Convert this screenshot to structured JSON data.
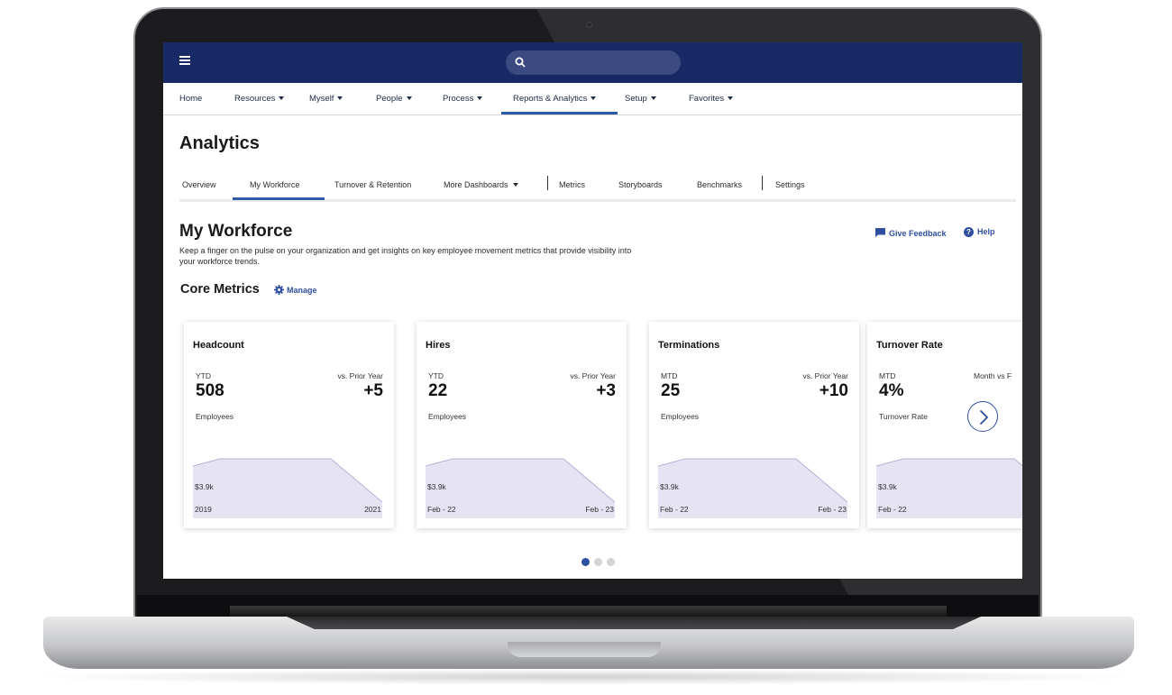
{
  "topbar": {
    "menu_icon": "hamburger-menu-icon",
    "search_icon": "search-icon",
    "colors": {
      "bar": "#172a66",
      "search": "#3b4a80"
    }
  },
  "main_nav": {
    "items": [
      {
        "label": "Home",
        "has_caret": false
      },
      {
        "label": "Resources",
        "has_caret": true
      },
      {
        "label": "Myself",
        "has_caret": true
      },
      {
        "label": "People",
        "has_caret": true
      },
      {
        "label": "Process",
        "has_caret": true
      },
      {
        "label": "Reports & Analytics",
        "has_caret": true,
        "active": true
      },
      {
        "label": "Setup",
        "has_caret": true
      },
      {
        "label": "Favorites",
        "has_caret": true
      }
    ]
  },
  "page": {
    "title": "Analytics"
  },
  "sub_tabs": {
    "items": [
      {
        "label": "Overview"
      },
      {
        "label": "My Workforce",
        "active": true
      },
      {
        "label": "Turnover & Retention"
      },
      {
        "label": "More Dashboards",
        "has_caret": true
      },
      {
        "label": "Metrics"
      },
      {
        "label": "Storyboards"
      },
      {
        "label": "Benchmarks"
      },
      {
        "label": "Settings"
      }
    ]
  },
  "section": {
    "title": "My Workforce",
    "description": "Keep a finger on the pulse on your organization and get insights on key employee movement metrics that provide visibility into your workforce trends.",
    "feedback_label": "Give Feedback",
    "help_label": "Help"
  },
  "core_metrics": {
    "title": "Core Metrics",
    "manage_label": "Manage",
    "cards": [
      {
        "title": "Headcount",
        "period": "YTD",
        "comparison": "vs. Prior Year",
        "value": "508",
        "delta": "+5",
        "unit": "Employees",
        "amount": "$3.9k",
        "start": "2019",
        "end": "2021"
      },
      {
        "title": "Hires",
        "period": "YTD",
        "comparison": "vs. Prior Year",
        "value": "22",
        "delta": "+3",
        "unit": "Employees",
        "amount": "$3.9k",
        "start": "Feb - 22",
        "end": "Feb - 23"
      },
      {
        "title": "Terminations",
        "period": "MTD",
        "comparison": "vs. Prior Year",
        "value": "25",
        "delta": "+10",
        "unit": "Employees",
        "amount": "$3.9k",
        "start": "Feb - 22",
        "end": "Feb - 23"
      },
      {
        "title": "Turnover Rate",
        "period": "MTD",
        "comparison": "Month vs F",
        "value": "4%",
        "delta": "",
        "unit": "Turnover Rate",
        "amount": "$3.9k",
        "start": "Feb - 22",
        "end": ""
      }
    ],
    "next_icon": "chevron-right-icon",
    "pagination": {
      "pages": 3,
      "current": 1
    }
  },
  "colors": {
    "accent": "#2f5aa8",
    "link": "#2f4fa0",
    "sparkline_fill": "#e6e3f2",
    "sparkline_stroke": "#b7b0d8"
  }
}
